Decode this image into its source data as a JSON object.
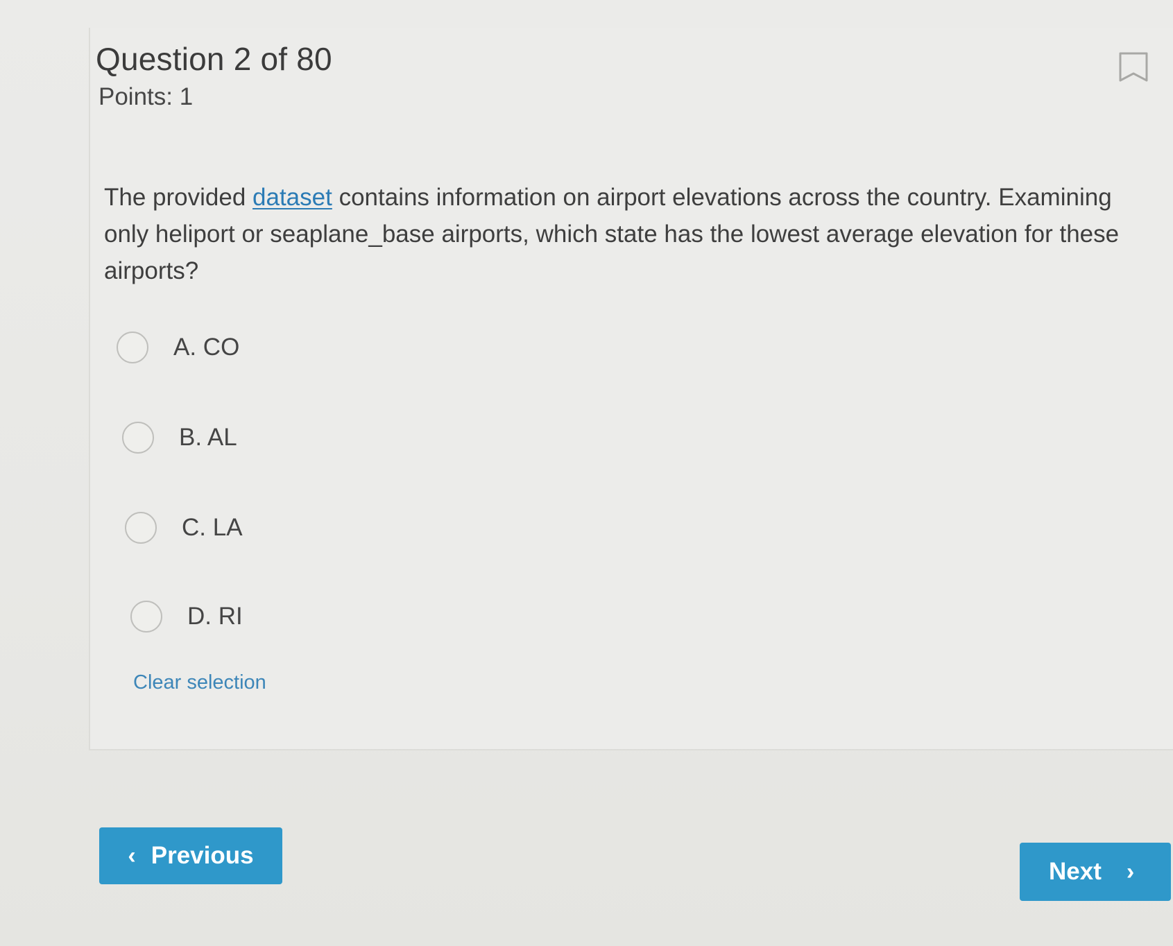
{
  "header": {
    "question_title": "Question 2 of 80",
    "points": "Points: 1",
    "bookmark_icon": "bookmark-icon"
  },
  "question": {
    "text_before": "The provided ",
    "link_text": "dataset",
    "text_after": " contains information on airport elevations across the country. Examining only heliport or seaplane_base airports, which state has the lowest average elevation for these airports?"
  },
  "options": [
    {
      "label": "A. CO"
    },
    {
      "label": "B. AL"
    },
    {
      "label": "C. LA"
    },
    {
      "label": "D. RI"
    }
  ],
  "clear_selection": "Clear selection",
  "nav": {
    "previous_label": "Previous",
    "next_label": "Next",
    "previous_icon": "chevron-left-icon",
    "next_icon": "chevron-right-icon",
    "accent_color": "#2f98ca",
    "link_color": "#2b7bb5"
  }
}
